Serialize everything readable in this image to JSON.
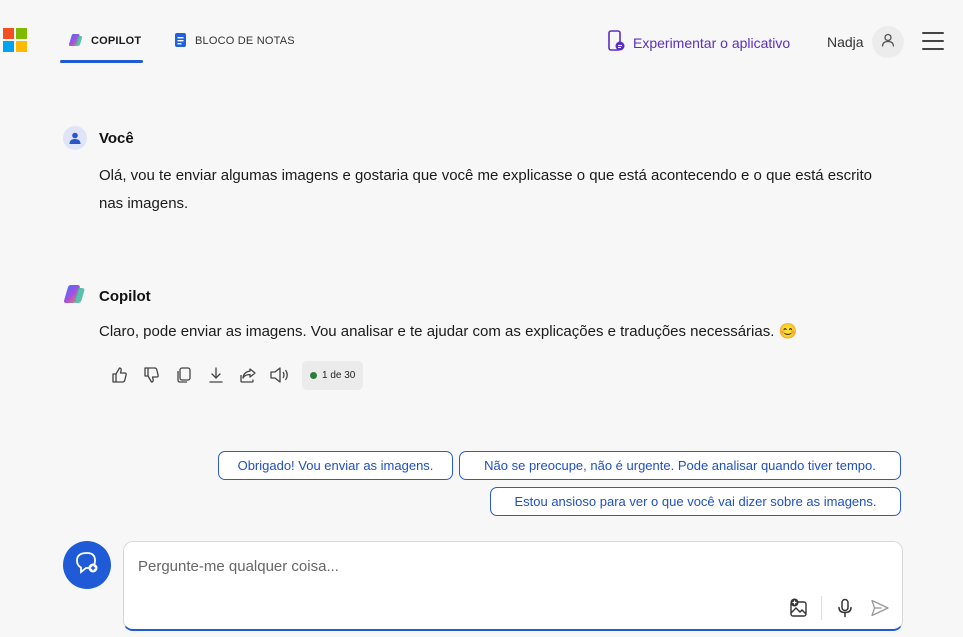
{
  "header": {
    "logo_colors": [
      "#f25022",
      "#7fba00",
      "#00a4ef",
      "#ffb900"
    ],
    "tabs": [
      {
        "label": "COPILOT",
        "icon": "copilot-icon",
        "active": true
      },
      {
        "label": "BLOCO DE NOTAS",
        "icon": "notebook-icon",
        "active": false
      }
    ],
    "try_app_label": "Experimentar o aplicativo",
    "user_name": "Nadja"
  },
  "conversation": {
    "user_message": {
      "author": "Você",
      "text": "Olá, vou te enviar algumas imagens e gostaria que você me explicasse o que está acontecendo e o que está escrito nas imagens."
    },
    "copilot_message": {
      "author": "Copilot",
      "text": "Claro, pode enviar as imagens. Vou analisar e te ajudar com as explicações e traduções necessárias. 😊"
    },
    "actions": [
      "thumbs-up-icon",
      "thumbs-down-icon",
      "copy-icon",
      "download-icon",
      "share-icon",
      "read-aloud-icon"
    ],
    "counter": "1 de 30"
  },
  "suggestions": [
    "Obrigado! Vou enviar as imagens.",
    "Não se preocupe, não é urgente. Pode analisar quando tiver tempo.",
    "Estou ansioso para ver o que você vai dizer sobre as imagens."
  ],
  "composer": {
    "placeholder": "Pergunte-me qualquer coisa...",
    "accent": "#1f5bd6"
  }
}
